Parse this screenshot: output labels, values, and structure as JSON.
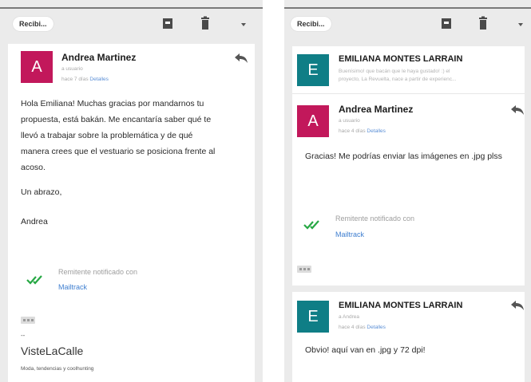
{
  "left": {
    "toolbar": {
      "inbox_label": "Recibi...",
      "icons": [
        "archive-icon",
        "trash-icon",
        "chevron-down-icon"
      ]
    },
    "message": {
      "avatar_letter": "A",
      "avatar_color": "#c2185b",
      "sender": "Andrea Martinez",
      "to": "a usuario",
      "date": "hace 7 días",
      "details_link": "Detalles",
      "body_lines": [
        "Hola Emiliana! Muchas gracias por mandarnos tu",
        "propuesta, está bakán. Me encantaría saber qué te",
        "llevó a trabajar sobre la problemática y de qué",
        "manera crees que el vestuario se posiciona frente al",
        "acoso."
      ],
      "closing": "Un abrazo,",
      "signature": "Andrea",
      "mailtrack_label": "Remitente notificado con",
      "mailtrack_link": "Mailtrack",
      "sig_dashes": "--",
      "brand_name": "VisteLaCalle",
      "brand_tagline": "Moda, tendencias y coolhunting"
    }
  },
  "right": {
    "toolbar": {
      "inbox_label": "Recibi...",
      "icons": [
        "archive-icon",
        "trash-icon",
        "chevron-down-icon"
      ]
    },
    "messages": [
      {
        "avatar_letter": "E",
        "avatar_color": "#0f7e86",
        "sender": "EMILIANA MONTES LARRAIN",
        "snippet_lines": [
          "Buenísimo! que bacán que le haya gustado! :) el",
          "proyecto, La Revuelta, nace a partir de experienc..."
        ]
      },
      {
        "avatar_letter": "A",
        "avatar_color": "#c2185b",
        "sender": "Andrea Martinez",
        "to": "a usuario",
        "date": "hace 4 días",
        "details_link": "Detalles",
        "body": "Gracias! Me podrías enviar las imágenes en .jpg plss",
        "mailtrack_label": "Remitente notificado con",
        "mailtrack_link": "Mailtrack"
      },
      {
        "avatar_letter": "E",
        "avatar_color": "#0f7e86",
        "sender": "EMILIANA MONTES LARRAIN",
        "to": "a Andrea",
        "date": "hace 4 días",
        "details_link": "Detalles",
        "body": "Obvio! aquí van en .jpg y 72 dpi!"
      }
    ]
  }
}
